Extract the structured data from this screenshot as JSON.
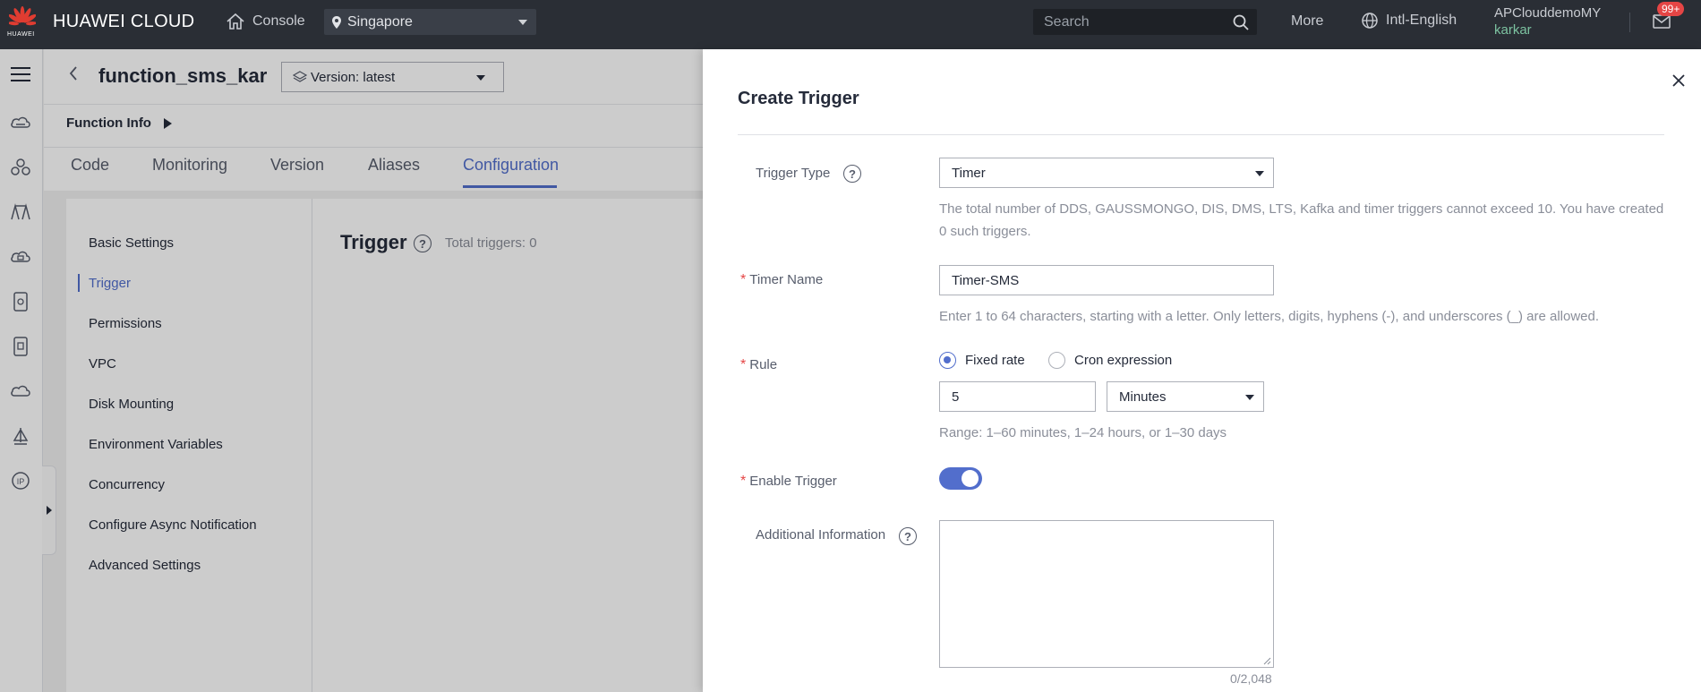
{
  "topbar": {
    "logo_text": "HUAWEI",
    "brand": "HUAWEI CLOUD",
    "console": "Console",
    "region": "Singapore",
    "search_placeholder": "Search",
    "more": "More",
    "language": "Intl-English",
    "account": "APClouddemoMY",
    "user": "karkar",
    "notifications": "99+"
  },
  "function": {
    "name": "function_sms_kar",
    "version": "Version: latest",
    "info_label": "Function Info"
  },
  "tabs": [
    {
      "label": "Code"
    },
    {
      "label": "Monitoring"
    },
    {
      "label": "Version"
    },
    {
      "label": "Aliases"
    },
    {
      "label": "Configuration",
      "active": true
    }
  ],
  "config_menu": [
    {
      "label": "Basic Settings"
    },
    {
      "label": "Trigger",
      "active": true
    },
    {
      "label": "Permissions"
    },
    {
      "label": "VPC"
    },
    {
      "label": "Disk Mounting"
    },
    {
      "label": "Environment Variables"
    },
    {
      "label": "Concurrency"
    },
    {
      "label": "Configure Async Notification"
    },
    {
      "label": "Advanced Settings"
    }
  ],
  "trigger_panel": {
    "title": "Trigger",
    "total": "Total triggers: 0"
  },
  "drawer": {
    "title": "Create Trigger",
    "trigger_type": {
      "label": "Trigger Type",
      "value": "Timer",
      "hint_line1": "The total number of DDS, GAUSSMONGO, DIS, DMS, LTS, Kafka and timer triggers cannot exceed 10. You have created",
      "hint_line2": "0 such triggers."
    },
    "timer_name": {
      "label": "Timer Name",
      "value": "Timer-SMS",
      "hint": "Enter 1 to 64 characters, starting with a letter. Only letters, digits, hyphens (-), and underscores (_) are allowed."
    },
    "rule": {
      "label": "Rule",
      "option_fixed": "Fixed rate",
      "option_cron": "Cron expression",
      "selected": "Fixed rate",
      "interval_value": "5",
      "unit": "Minutes",
      "hint": "Range: 1–60 minutes, 1–24 hours, or 1–30 days"
    },
    "enable_trigger": {
      "label": "Enable Trigger",
      "enabled": true
    },
    "additional_info": {
      "label": "Additional Information",
      "value": "",
      "counter": "0/2,048"
    }
  },
  "colors": {
    "topbar": "#2a2e35",
    "accent": "#526ecc",
    "required": "#e54545",
    "brand_red": "#e54545"
  }
}
